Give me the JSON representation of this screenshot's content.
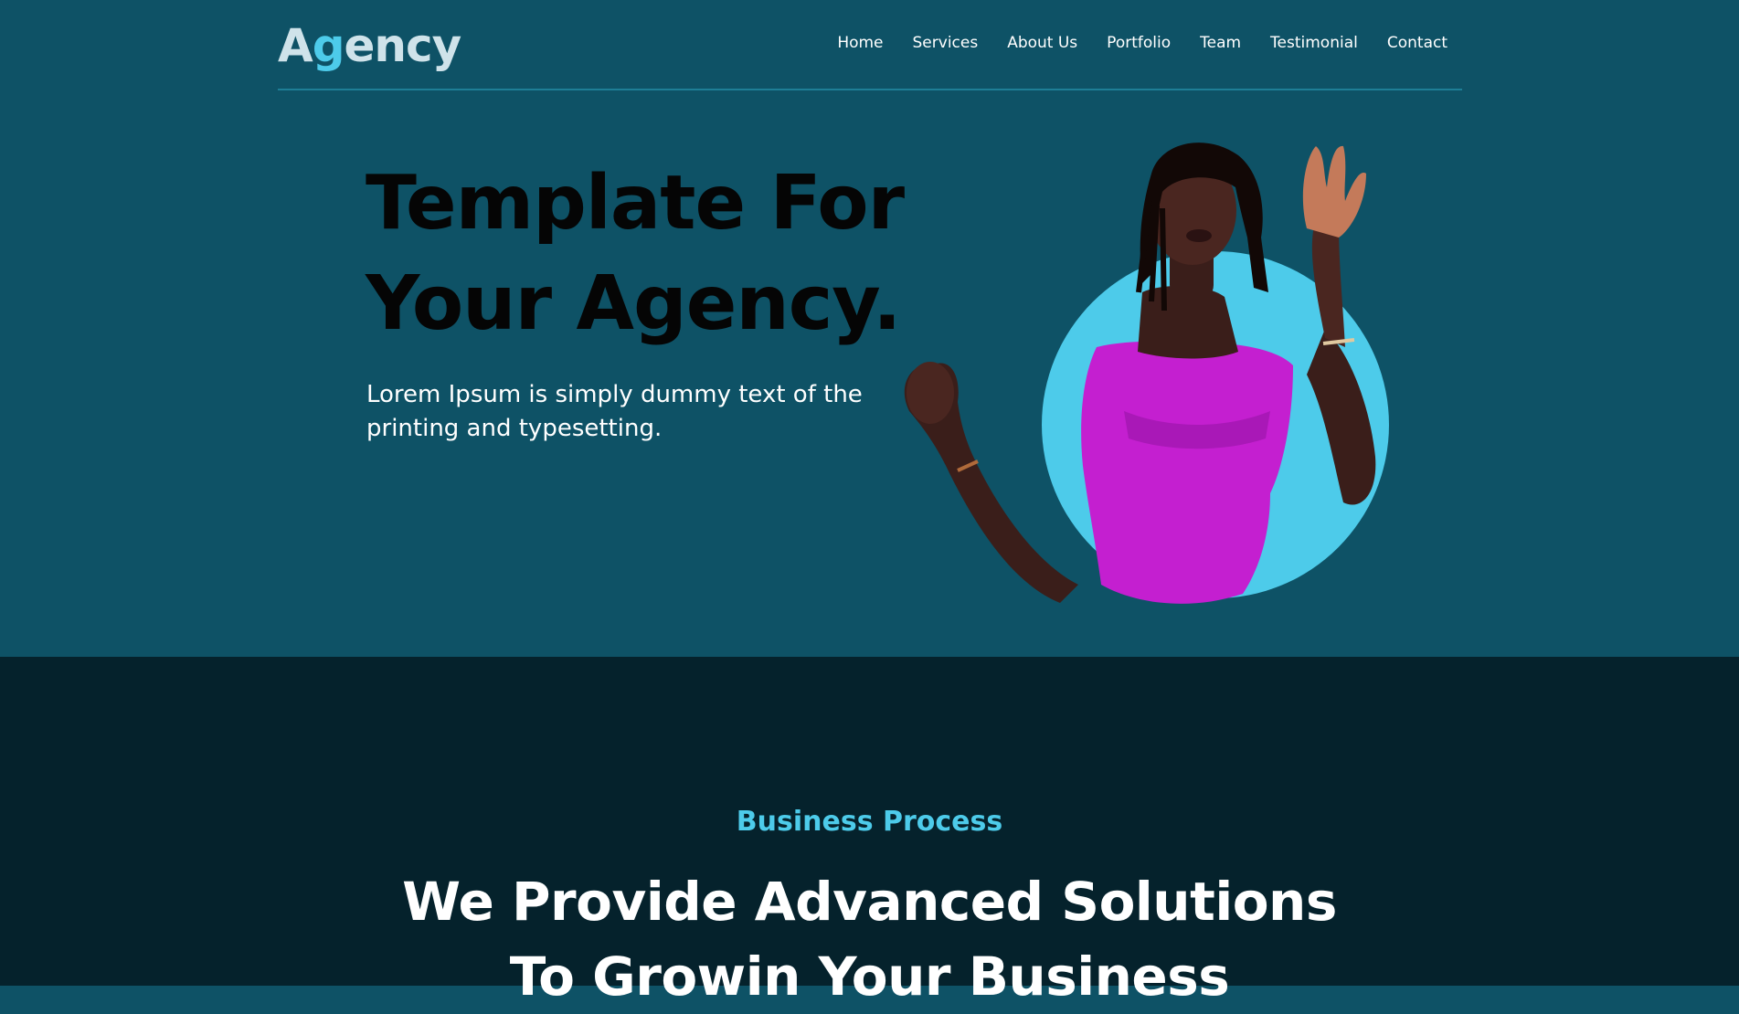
{
  "logo": {
    "first": "A",
    "accent": "g",
    "rest": "ency"
  },
  "nav": [
    "Home",
    "Services",
    "About Us",
    "Portfolio",
    "Team",
    "Testimonial",
    "Contact"
  ],
  "hero": {
    "title_line1": "Template For",
    "title_line2": "Your Agency.",
    "subtitle_line1": "Lorem Ipsum is simply dummy text of the",
    "subtitle_line2": "printing and typesetting."
  },
  "process": {
    "eyebrow": "Business Process",
    "title_line1": "We Provide Advanced Solutions",
    "title_line2": "To Growin Your Business"
  },
  "colors": {
    "hero_bg": "#0e5266",
    "section_bg": "#05222c",
    "accent": "#4dcbea",
    "dress": "#c41fd0"
  },
  "icons": {
    "hero_image": "woman-in-purple-dress-image"
  }
}
